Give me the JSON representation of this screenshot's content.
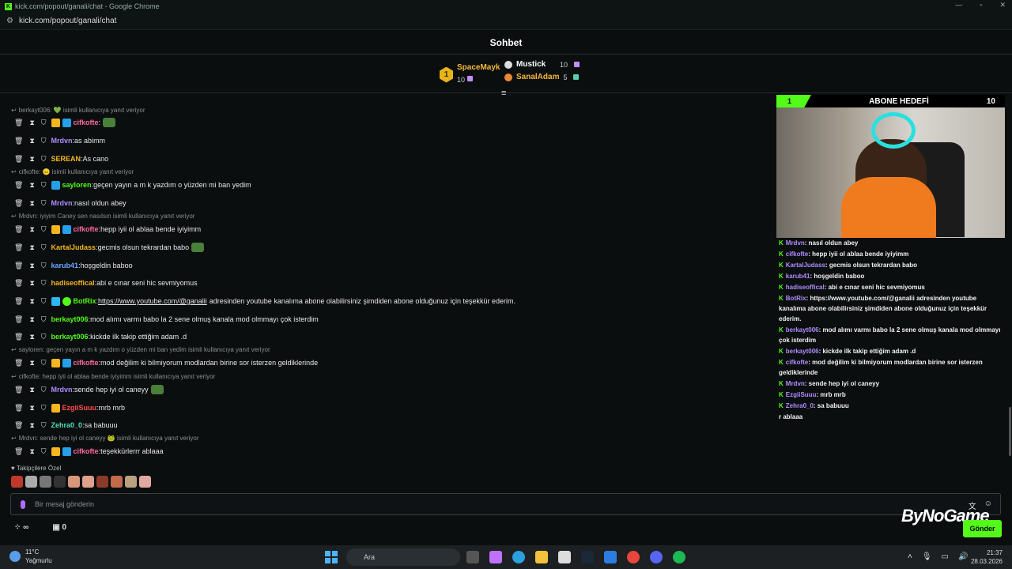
{
  "window": {
    "title": "kick.com/popout/ganali/chat - Google Chrome",
    "url": "kick.com/popout/ganali/chat"
  },
  "header": {
    "title": "Sohbet"
  },
  "leaderboard": {
    "first": {
      "rank": "1",
      "name": "SpaceMayk",
      "value": "10"
    },
    "others": [
      {
        "name": "Mustick",
        "value": "10"
      },
      {
        "name": "SanalAdam",
        "value": "5"
      }
    ]
  },
  "messages": [
    {
      "type": "reply",
      "text": "berkayt006: 💚 isimli kullanıcıya yanıt veriyor"
    },
    {
      "type": "msg",
      "user": "cifkofte",
      "color": "#ff6b9e",
      "text": "",
      "badges": [
        "crown",
        "sub"
      ],
      "emote": true
    },
    {
      "type": "msg",
      "user": "Mrdvn",
      "color": "#b08cff",
      "text": "as abimm",
      "badges": []
    },
    {
      "type": "msg",
      "user": "SEREAN",
      "color": "#f5b622",
      "text": "As cano",
      "badges": []
    },
    {
      "type": "reply",
      "text": "cifkofte: 😐 isimli kullanıcıya yanıt veriyor"
    },
    {
      "type": "msg",
      "user": "sayloren",
      "color": "#53fc18",
      "text": "geçen yayın a m k yazdım o yüzden mi ban yedim",
      "badges": [
        "sub"
      ]
    },
    {
      "type": "msg",
      "user": "Mrdvn",
      "color": "#b08cff",
      "text": "nasıl oldun abey",
      "badges": []
    },
    {
      "type": "reply",
      "text": "Mrdvn: iyiyim Caney sen nasılsın isimli kullanıcıya yanıt veriyor"
    },
    {
      "type": "msg",
      "user": "cifkofte",
      "color": "#ff6b9e",
      "text": "hepp iyii ol ablaa bende iyiyimm",
      "badges": [
        "crown",
        "sub"
      ]
    },
    {
      "type": "msg",
      "user": "KartalJudass",
      "color": "#f5b622",
      "text": "gecmis olsun tekrardan babo",
      "badges": [],
      "emote": true
    },
    {
      "type": "msg",
      "user": "karub41",
      "color": "#6aa8ff",
      "text": "hoşgeldin baboo",
      "badges": []
    },
    {
      "type": "msg",
      "user": "hadiseoffical",
      "color": "#f5b622",
      "text": "abi e cınar seni hic sevmiyomus",
      "badges": []
    },
    {
      "type": "msg",
      "user": "BotRix",
      "color": "#53fc18",
      "link": "https://www.youtube.com/@ganalii",
      "text": "adresinden youtube kanalıma abone olabilirsiniz şimdiden abone olduğunuz için teşekkür ederim.",
      "badges": [
        "bot",
        "verified"
      ]
    },
    {
      "type": "msg",
      "user": "berkayt006",
      "color": "#53fc18",
      "text": "mod alımı varmı babo la 2 sene olmuş kanala mod olmmayı çok isterdim",
      "badges": []
    },
    {
      "type": "msg",
      "user": "berkayt006",
      "color": "#53fc18",
      "text": "kickde ilk takip ettiğim adam .d",
      "badges": []
    },
    {
      "type": "reply",
      "text": "sayloren: geçen yayın a m k yazdım o yüzden mi ban yedim isimli kullanıcıya yanıt veriyor"
    },
    {
      "type": "msg",
      "user": "cifkofte",
      "color": "#ff6b9e",
      "text": "mod değilim ki bilmiyorum modlardan birine sor isterzen geldiklerinde",
      "badges": [
        "crown",
        "sub"
      ]
    },
    {
      "type": "reply",
      "text": "cifkofte: hepp iyii ol ablaa bende iyiyimm isimli kullanıcıya yanıt veriyor"
    },
    {
      "type": "msg",
      "user": "Mrdvn",
      "color": "#b08cff",
      "text": "sende hep iyi ol caneyy",
      "badges": [],
      "emote": true
    },
    {
      "type": "msg",
      "user": "EzgiiSuuu",
      "color": "#ff4d4d",
      "text": "mrb mrb",
      "badges": [
        "crown"
      ]
    },
    {
      "type": "msg",
      "user": "Zehra0_0",
      "color": "#4ee1b8",
      "text": "sa babuuu",
      "badges": []
    },
    {
      "type": "reply",
      "text": "Mrdvn: sende hep iyi ol caneyy 🐸 isimli kullanıcıya yanıt veriyor"
    },
    {
      "type": "msg",
      "user": "cifkofte",
      "color": "#ff6b9e",
      "text": "teşekkürlerrr ablaaa",
      "badges": [
        "crown",
        "sub"
      ]
    }
  ],
  "followers_label": "Takipçilere Özel",
  "input": {
    "placeholder": "Bir mesaj gönderin",
    "send_label": "Gönder"
  },
  "bottom": {
    "icon_count": "∞",
    "gift_count": "0"
  },
  "overlay": {
    "goal_left": "1",
    "goal_title": "ABONE HEDEFİ",
    "goal_count": "10",
    "lines": [
      {
        "user": "Mrdvn",
        "text": ": nasıl oldun abey"
      },
      {
        "user": "cifkofte",
        "text": ": hepp iyii ol ablaa bende iyiyimm"
      },
      {
        "user": "KartalJudass",
        "text": ": gecmis olsun tekrardan babo"
      },
      {
        "user": "karub41",
        "text": ": hoşgeldin baboo"
      },
      {
        "user": "hadiseoffical",
        "text": ": abi e cınar seni hic sevmiyomus"
      },
      {
        "user": "BotRix",
        "text": ": https://www.youtube.com/@ganalii adresinden youtube kanalıma abone olabilirsiniz şimdiden abone olduğunuz için teşekkür ederim."
      },
      {
        "user": "berkayt006",
        "text": ": mod alımı varmı babo la 2 sene olmuş kanala mod olmmayı çok isterdim"
      },
      {
        "user": "berkayt006",
        "text": ": kickde ilk takip ettiğim adam .d"
      },
      {
        "user": "cifkofte",
        "text": ": mod değilim ki bilmiyorum modlardan birine sor isterzen geldiklerinde"
      },
      {
        "user": "Mrdvn",
        "text": ": sende hep iyi ol caneyy"
      },
      {
        "user": "EzgiiSuuu",
        "text": ": mrb mrb"
      },
      {
        "user": "Zehra0_0",
        "text": ": sa babuuu"
      },
      {
        "user": "",
        "text": "r ablaaa"
      }
    ]
  },
  "brand": "ByNoGame",
  "taskbar": {
    "temp": "11°C",
    "weather": "Yağmurlu",
    "search": "Ara",
    "time": "21:37",
    "date": "28.03.2026"
  }
}
